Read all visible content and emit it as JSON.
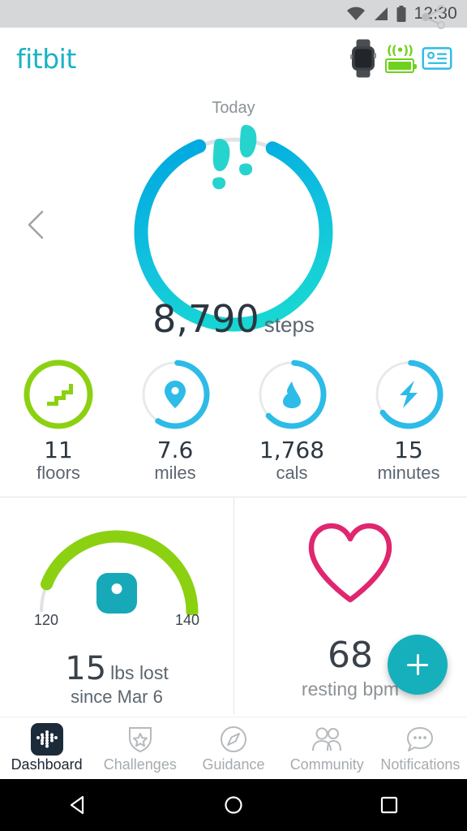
{
  "status_bar": {
    "time": "12:30",
    "icons": [
      "wifi-icon",
      "cellular-signal-icon",
      "battery-icon"
    ]
  },
  "header": {
    "brand": "fitbit",
    "device_icon": "smartwatch-icon",
    "sync_icon": "bluetooth-sync-icon",
    "sync_wave": "((•))",
    "device_battery_icon": "device-battery-icon",
    "account_icon": "account-card-icon",
    "accent_color": "#1ab2c4"
  },
  "today": {
    "label": "Today",
    "share_icon": "share-icon",
    "prev_icon": "chevron-left-icon"
  },
  "hero": {
    "icon": "footprints-icon",
    "value": "8,790",
    "unit": "steps",
    "progress_percent": 87,
    "gradient_from": "#18d8d2",
    "gradient_to": "#00a9e0",
    "track_color": "#e0e2e4"
  },
  "stats": [
    {
      "name": "floors",
      "icon": "stairs-icon",
      "value": "11",
      "unit": "floors",
      "progress_percent": 100,
      "color": "#8bd111"
    },
    {
      "name": "miles",
      "icon": "location-pin-icon",
      "value": "7.6",
      "unit": "miles",
      "progress_percent": 58,
      "color": "#2dbbe8"
    },
    {
      "name": "cals",
      "icon": "flame-icon",
      "value": "1,768",
      "unit": "cals",
      "progress_percent": 62,
      "color": "#2dbbe8"
    },
    {
      "name": "minutes",
      "icon": "lightning-icon",
      "value": "15",
      "unit": "minutes",
      "progress_percent": 64,
      "color": "#2dbbe8"
    }
  ],
  "weight_card": {
    "icon": "scale-icon",
    "gauge_min": "120",
    "gauge_max": "140",
    "gauge_percent": 88,
    "gauge_color": "#8bd111",
    "gauge_track": "#e0e2e4",
    "value": "15",
    "unit": "lbs lost",
    "subtitle": "since Mar 6"
  },
  "heart_card": {
    "icon": "heart-icon",
    "icon_color": "#e0266f",
    "value": "68",
    "label": "resting bpm"
  },
  "fab": {
    "icon": "plus-icon",
    "color": "#16b0bd"
  },
  "tabs": [
    {
      "label": "Dashboard",
      "icon": "fitbit-logo-icon",
      "active": true
    },
    {
      "label": "Challenges",
      "icon": "shield-star-icon",
      "active": false
    },
    {
      "label": "Guidance",
      "icon": "compass-icon",
      "active": false
    },
    {
      "label": "Community",
      "icon": "people-icon",
      "active": false
    },
    {
      "label": "Notifications",
      "icon": "chat-bubble-icon",
      "active": false
    }
  ],
  "android_nav": {
    "back_icon": "back-triangle-icon",
    "home_icon": "home-circle-icon",
    "recents_icon": "recents-square-icon"
  }
}
